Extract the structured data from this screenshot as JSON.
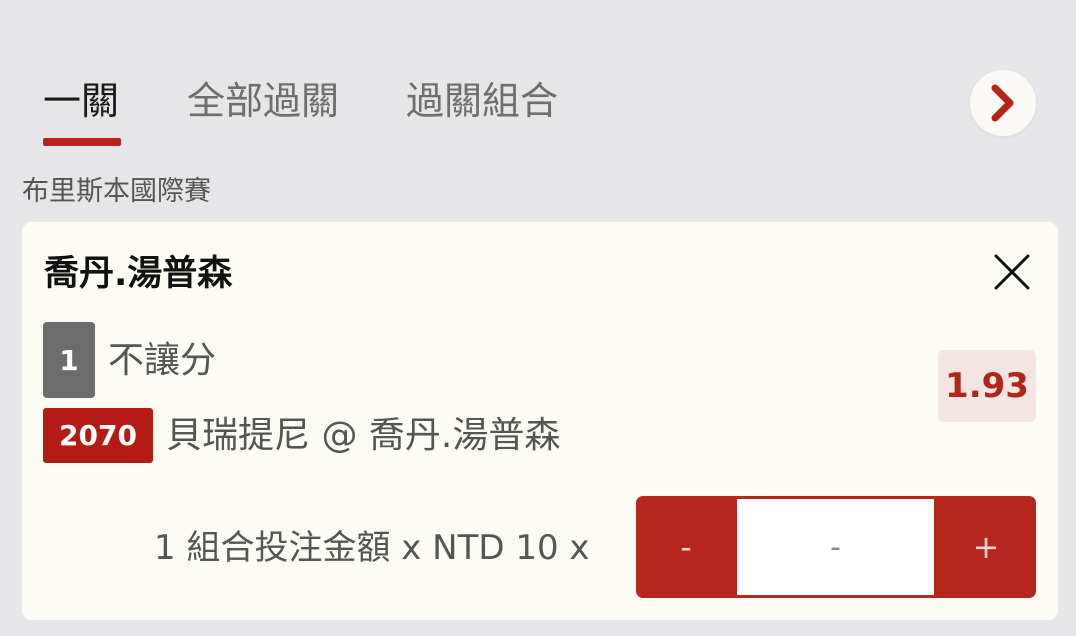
{
  "tabs": [
    {
      "label": "一關",
      "active": true
    },
    {
      "label": "全部過關",
      "active": false
    },
    {
      "label": "過關組合",
      "active": false
    }
  ],
  "next_icon": "chevron-right-icon",
  "league": "布里斯本國際賽",
  "bet": {
    "player": "喬丹.湯普森",
    "close_icon": "close-icon",
    "selection_number": "1",
    "bet_type": "不讓分",
    "odds": "1.93",
    "match_code": "2070",
    "match": "貝瑞提尼 @ 喬丹.湯普森"
  },
  "stake": {
    "label": "1 組合投注金額 x NTD 10 x",
    "minus": "-",
    "placeholder": "-",
    "plus": "+"
  },
  "colors": {
    "accent": "#b8231a",
    "background": "#e6e6e8",
    "card": "#fdfcf4",
    "odds_bg": "#f3e6e2",
    "selection_badge": "#6c6c6c"
  }
}
